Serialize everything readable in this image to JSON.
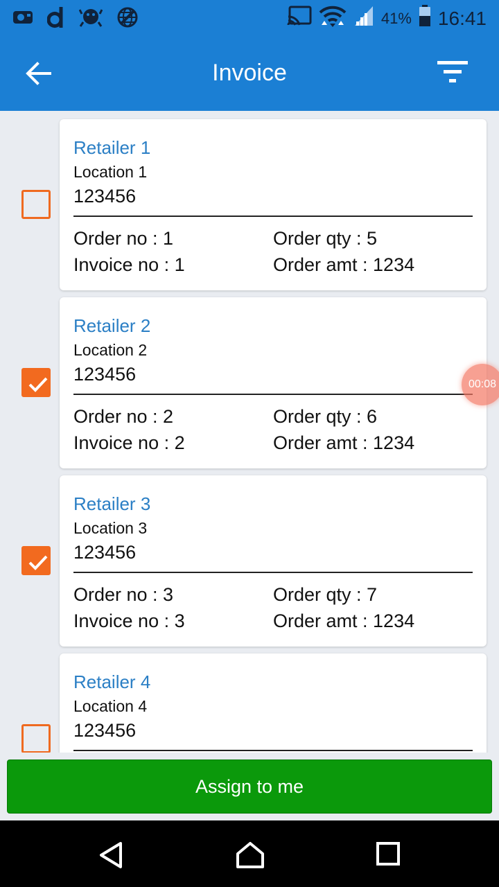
{
  "status_bar": {
    "battery_percent": "41%",
    "time": "16:41",
    "left_icons": [
      "camera-app-icon",
      "d-app-icon",
      "crab-app-icon",
      "globe-blocked-icon"
    ],
    "right_icons": [
      "cast-icon",
      "wifi-icon",
      "signal-icon",
      "battery-icon"
    ]
  },
  "app_bar": {
    "title": "Invoice",
    "back_icon": "arrow-left-icon",
    "filter_icon": "filter-icon",
    "background_color": "#1b7fd4"
  },
  "invoices": [
    {
      "checked": false,
      "retailer": "Retailer 1",
      "location": "Location 1",
      "code": "123456",
      "order_no": "Order no : 1",
      "order_qty": "Order qty : 5",
      "invoice_no": "Invoice no : 1",
      "order_amt": "Order amt : 1234"
    },
    {
      "checked": true,
      "retailer": "Retailer 2",
      "location": "Location 2",
      "code": "123456",
      "order_no": "Order no : 2",
      "order_qty": "Order qty : 6",
      "invoice_no": "Invoice no : 2",
      "order_amt": "Order amt : 1234"
    },
    {
      "checked": true,
      "retailer": "Retailer 3",
      "location": "Location 3",
      "code": "123456",
      "order_no": "Order no : 3",
      "order_qty": "Order qty : 7",
      "invoice_no": "Invoice no : 3",
      "order_amt": "Order amt : 1234"
    },
    {
      "checked": false,
      "retailer": "Retailer 4",
      "location": "Location 4",
      "code": "123456"
    }
  ],
  "assign_button": {
    "label": "Assign to me",
    "color": "#0b990b"
  },
  "screen_recorder": {
    "elapsed": "00:08"
  },
  "nav_bar": {
    "icons": [
      "back-triangle-icon",
      "home-icon",
      "recents-square-icon"
    ]
  },
  "accent_color": "#f26a1f"
}
